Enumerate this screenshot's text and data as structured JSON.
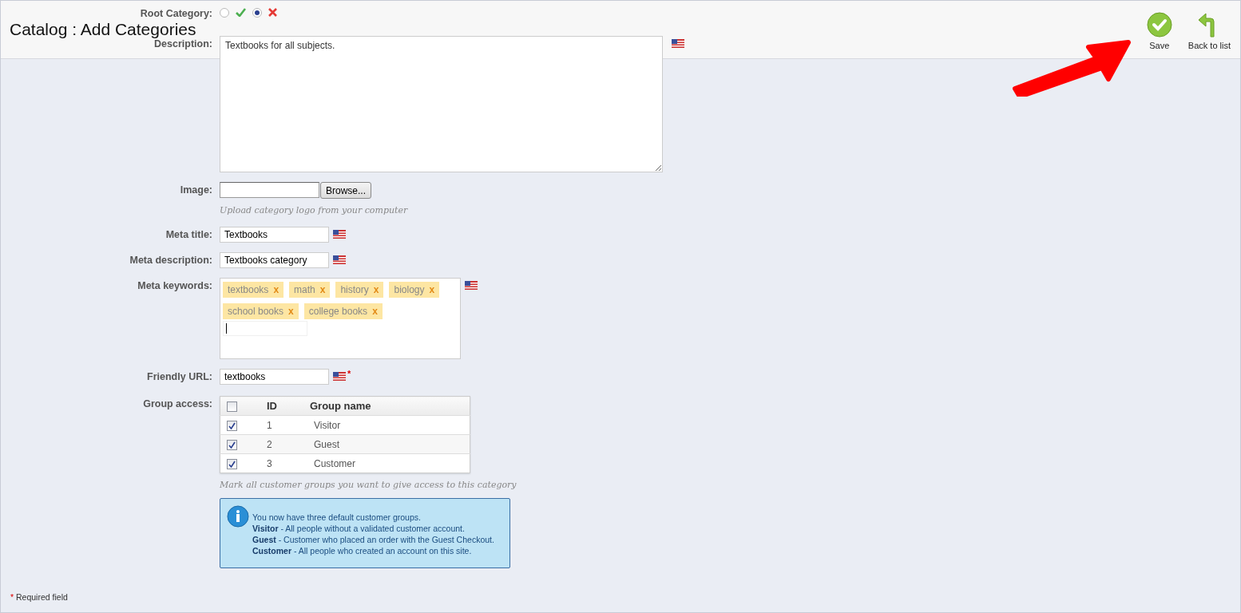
{
  "header": {
    "title": "Catalog : Add Categories",
    "buttons": [
      {
        "kind": "save",
        "label": "Save"
      },
      {
        "kind": "back",
        "label": "Back to list"
      }
    ]
  },
  "root_category": {
    "label": "Root Category:",
    "options": [
      {
        "kind": "yes",
        "selected": false
      },
      {
        "kind": "no",
        "selected": true
      }
    ]
  },
  "description": {
    "label": "Description:",
    "value": "Textbooks for all subjects."
  },
  "image": {
    "label": "Image:",
    "browse": "Browse...",
    "hint": "Upload category logo from your computer"
  },
  "meta_title": {
    "label": "Meta title:",
    "value": "Textbooks"
  },
  "meta_description": {
    "label": "Meta description:",
    "value": "Textbooks category"
  },
  "meta_keywords": {
    "label": "Meta keywords:",
    "tags": [
      {
        "text": "textbooks",
        "remove": "x"
      },
      {
        "text": "math",
        "remove": "x"
      },
      {
        "text": "history",
        "remove": "x"
      },
      {
        "text": "biology",
        "remove": "x"
      },
      {
        "text": "school books",
        "remove": "x"
      },
      {
        "text": "college books",
        "remove": "x"
      }
    ]
  },
  "friendly_url": {
    "label": "Friendly URL:",
    "value": "textbooks",
    "required_mark": "*"
  },
  "group_access": {
    "label": "Group access:",
    "all_checked": false,
    "columns": [
      "ID",
      "Group name"
    ],
    "rows": [
      {
        "checked": true,
        "id": "1",
        "name": "Visitor"
      },
      {
        "checked": true,
        "id": "2",
        "name": "Guest"
      },
      {
        "checked": true,
        "id": "3",
        "name": "Customer"
      }
    ],
    "hint": "Mark all customer groups you want to give access to this category"
  },
  "info": {
    "lines": [
      "You now have three default customer groups.",
      "**Visitor** - All people without a validated customer account.",
      "**Guest** - Customer who placed an order with the Guest Checkout.",
      "**Customer** - All people who created an account on this site."
    ]
  },
  "footer": {
    "mark": "*",
    "text": "Required field"
  }
}
